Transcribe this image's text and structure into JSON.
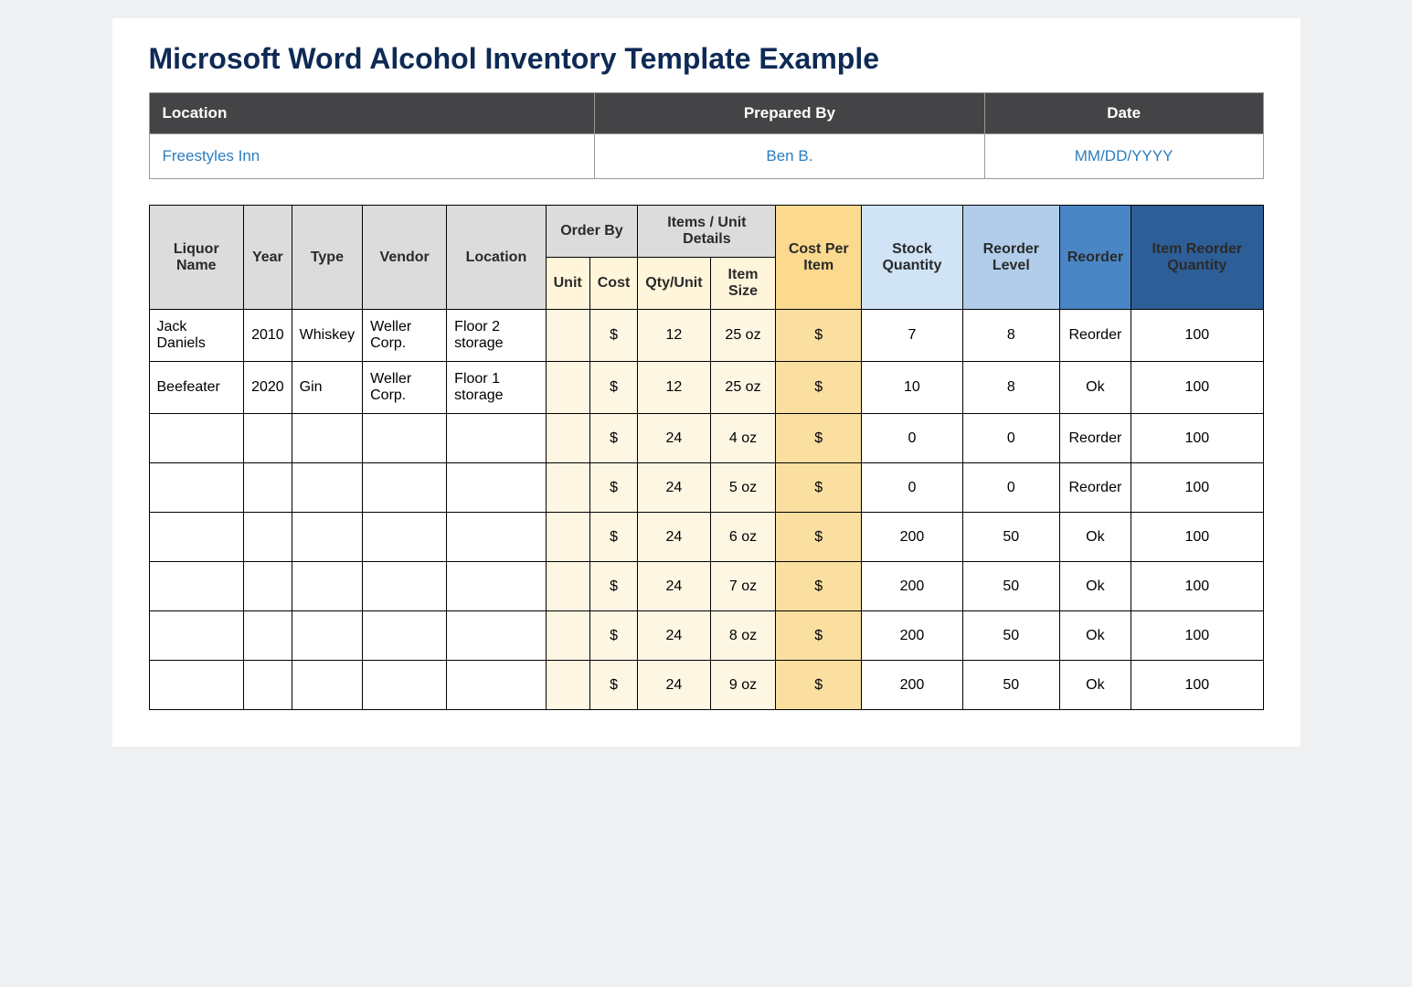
{
  "title": "Microsoft Word Alcohol Inventory Template Example",
  "info_headers": {
    "location": "Location",
    "prepared_by": "Prepared By",
    "date": "Date"
  },
  "info_values": {
    "location": "Freestyles Inn",
    "prepared_by": "Ben B.",
    "date": "MM/DD/YYYY"
  },
  "inv_headers": {
    "liquor_name": "Liquor Name",
    "year": "Year",
    "type": "Type",
    "vendor": "Vendor",
    "location": "Location",
    "order_by": "Order By",
    "order_unit": "Unit",
    "order_cost": "Cost",
    "item_unit_details": "Items / Unit Details",
    "qty_unit": "Qty/Unit",
    "item_size": "Item Size",
    "cost_per_item": "Cost Per Item",
    "stock_qty": "Stock Quantity",
    "reorder_level": "Reorder Level",
    "reorder": "Reorder",
    "item_reorder_qty": "Item Reorder Quantity"
  },
  "rows": [
    {
      "name": "Jack Daniels",
      "year": "2010",
      "type": "Whiskey",
      "vendor": "Weller Corp.",
      "location": "Floor 2 storage",
      "order_unit": "",
      "order_cost": "$",
      "qty_unit": "12",
      "item_size": "25 oz",
      "cost_per_item": "$",
      "stock_qty": "7",
      "reorder_level": "8",
      "reorder": "Reorder",
      "reorder_qty": "100"
    },
    {
      "name": "Beefeater",
      "year": "2020",
      "type": "Gin",
      "vendor": "Weller Corp.",
      "location": "Floor 1 storage",
      "order_unit": "",
      "order_cost": "$",
      "qty_unit": "12",
      "item_size": "25 oz",
      "cost_per_item": "$",
      "stock_qty": "10",
      "reorder_level": "8",
      "reorder": "Ok",
      "reorder_qty": "100"
    },
    {
      "name": "",
      "year": "",
      "type": "",
      "vendor": "",
      "location": "",
      "order_unit": "",
      "order_cost": "$",
      "qty_unit": "24",
      "item_size": "4 oz",
      "cost_per_item": "$",
      "stock_qty": "0",
      "reorder_level": "0",
      "reorder": "Reorder",
      "reorder_qty": "100"
    },
    {
      "name": "",
      "year": "",
      "type": "",
      "vendor": "",
      "location": "",
      "order_unit": "",
      "order_cost": "$",
      "qty_unit": "24",
      "item_size": "5 oz",
      "cost_per_item": "$",
      "stock_qty": "0",
      "reorder_level": "0",
      "reorder": "Reorder",
      "reorder_qty": "100"
    },
    {
      "name": "",
      "year": "",
      "type": "",
      "vendor": "",
      "location": "",
      "order_unit": "",
      "order_cost": "$",
      "qty_unit": "24",
      "item_size": "6 oz",
      "cost_per_item": "$",
      "stock_qty": "200",
      "reorder_level": "50",
      "reorder": "Ok",
      "reorder_qty": "100"
    },
    {
      "name": "",
      "year": "",
      "type": "",
      "vendor": "",
      "location": "",
      "order_unit": "",
      "order_cost": "$",
      "qty_unit": "24",
      "item_size": "7 oz",
      "cost_per_item": "$",
      "stock_qty": "200",
      "reorder_level": "50",
      "reorder": "Ok",
      "reorder_qty": "100"
    },
    {
      "name": "",
      "year": "",
      "type": "",
      "vendor": "",
      "location": "",
      "order_unit": "",
      "order_cost": "$",
      "qty_unit": "24",
      "item_size": "8 oz",
      "cost_per_item": "$",
      "stock_qty": "200",
      "reorder_level": "50",
      "reorder": "Ok",
      "reorder_qty": "100"
    },
    {
      "name": "",
      "year": "",
      "type": "",
      "vendor": "",
      "location": "",
      "order_unit": "",
      "order_cost": "$",
      "qty_unit": "24",
      "item_size": "9 oz",
      "cost_per_item": "$",
      "stock_qty": "200",
      "reorder_level": "50",
      "reorder": "Ok",
      "reorder_qty": "100"
    }
  ]
}
